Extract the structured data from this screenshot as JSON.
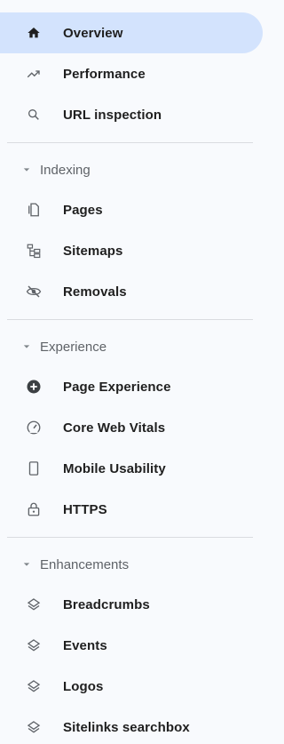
{
  "nav": {
    "top_items": [
      {
        "label": "Overview",
        "icon": "home-icon"
      },
      {
        "label": "Performance",
        "icon": "trending-up-icon"
      },
      {
        "label": "URL inspection",
        "icon": "search-icon"
      }
    ],
    "active": "Overview",
    "accent_color": "#d3e3fd"
  },
  "sections": [
    {
      "title": "Indexing",
      "items": [
        {
          "label": "Pages",
          "icon": "pages-icon"
        },
        {
          "label": "Sitemaps",
          "icon": "sitemap-icon"
        },
        {
          "label": "Removals",
          "icon": "visibility-off-icon"
        }
      ]
    },
    {
      "title": "Experience",
      "items": [
        {
          "label": "Page Experience",
          "icon": "add-circle-icon"
        },
        {
          "label": "Core Web Vitals",
          "icon": "speed-gauge-icon"
        },
        {
          "label": "Mobile Usability",
          "icon": "smartphone-icon"
        },
        {
          "label": "HTTPS",
          "icon": "lock-icon"
        }
      ]
    },
    {
      "title": "Enhancements",
      "items": [
        {
          "label": "Breadcrumbs",
          "icon": "layers-icon"
        },
        {
          "label": "Events",
          "icon": "layers-icon"
        },
        {
          "label": "Logos",
          "icon": "layers-icon"
        },
        {
          "label": "Sitelinks searchbox",
          "icon": "layers-icon"
        }
      ]
    }
  ]
}
